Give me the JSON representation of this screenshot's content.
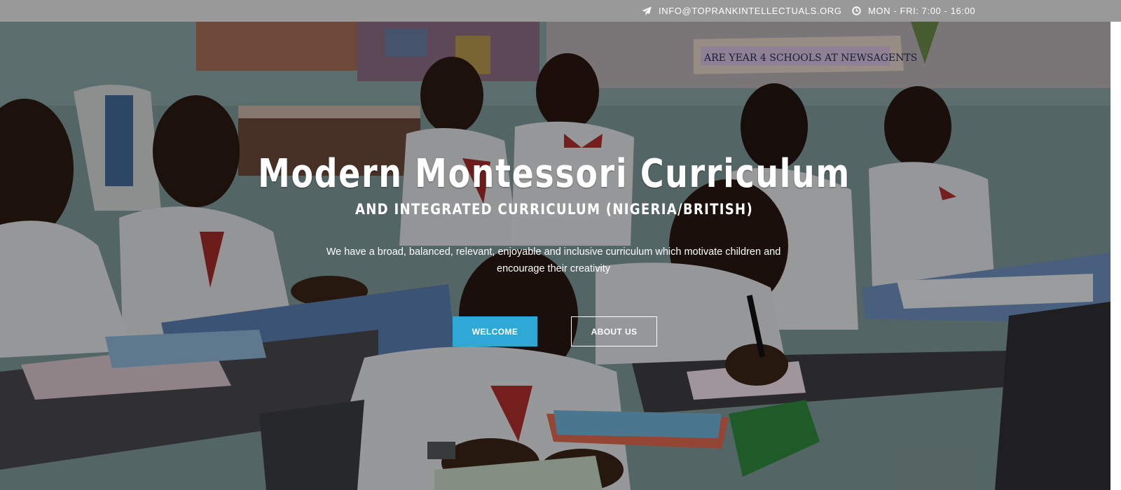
{
  "topbar": {
    "email": "INFO@TOPRANKINTELLECTUALS.ORG",
    "hours": "MON - FRI: 7:00 - 16:00",
    "email_icon": "paper-plane-icon",
    "hours_icon": "clock-icon",
    "background": "#999999"
  },
  "hero": {
    "title": "Modern Montessori Curriculum",
    "subtitle": "AND INTEGRATED CURRICULUM (NIGERIA/BRITISH)",
    "description": "We have a broad, balanced, relevant, enjoyable and inclusive curriculum which motivate children and encourage their creativity",
    "welcome_label": "WELCOME",
    "about_label": "ABOUT US",
    "accent_color": "#2ea9d6",
    "poster_text": "ARE YEAR 4 SCHOOLS AT NEWSAGENTS"
  }
}
